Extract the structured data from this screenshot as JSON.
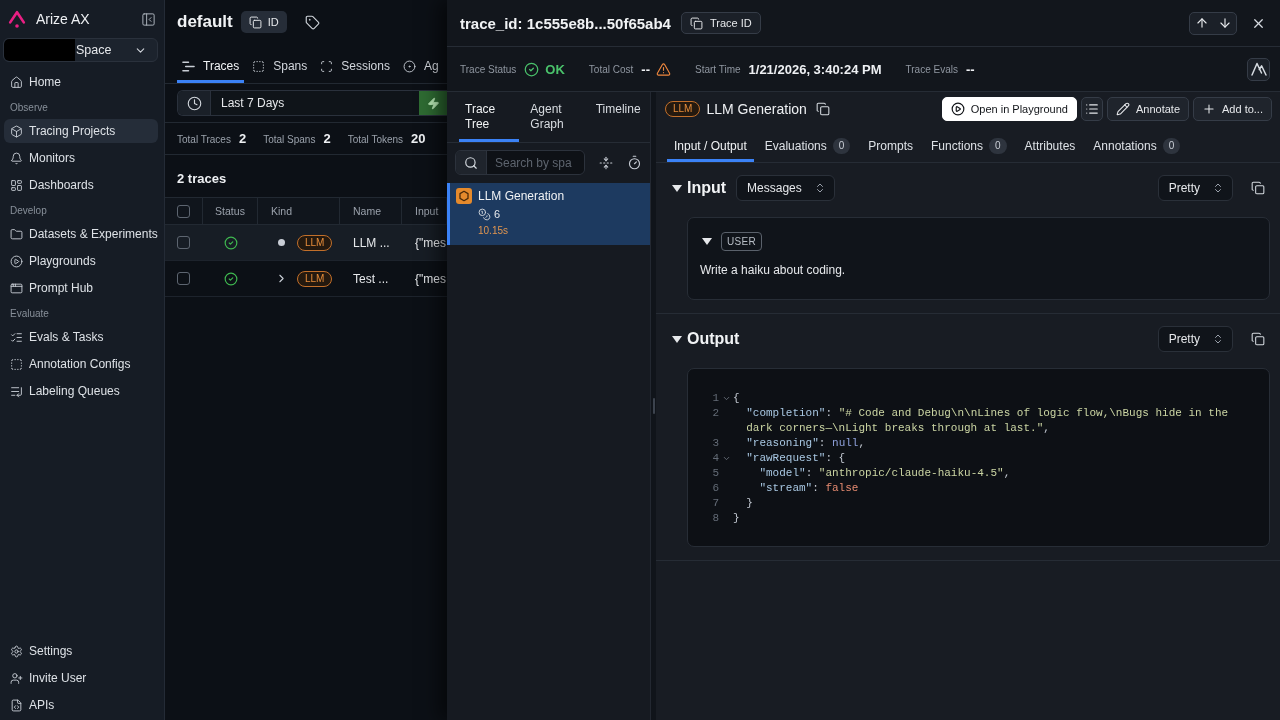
{
  "sidebar": {
    "brand": "Arize AX",
    "workspace": "Space",
    "groups": [
      {
        "items": [
          {
            "label": "Home",
            "selected": false
          }
        ]
      },
      {
        "heading": "Observe",
        "items": [
          {
            "label": "Tracing Projects",
            "selected": true
          },
          {
            "label": "Monitors",
            "selected": false
          },
          {
            "label": "Dashboards",
            "selected": false
          }
        ]
      },
      {
        "heading": "Develop",
        "items": [
          {
            "label": "Datasets & Experiments",
            "selected": false
          },
          {
            "label": "Playgrounds",
            "selected": false
          },
          {
            "label": "Prompt Hub",
            "selected": false
          }
        ]
      },
      {
        "heading": "Evaluate",
        "items": [
          {
            "label": "Evals & Tasks",
            "selected": false
          },
          {
            "label": "Annotation Configs",
            "selected": false
          },
          {
            "label": "Labeling Queues",
            "selected": false
          }
        ]
      }
    ],
    "footer_items": [
      {
        "label": "Settings",
        "selected": false
      },
      {
        "label": "Invite User",
        "selected": false
      },
      {
        "label": "APIs",
        "selected": false
      }
    ]
  },
  "project": {
    "title": "default",
    "id_button": "ID",
    "tabs": [
      {
        "label": "Traces",
        "selected": true
      },
      {
        "label": "Spans",
        "selected": false
      },
      {
        "label": "Sessions",
        "selected": false
      },
      {
        "label": "Ag",
        "selected": false
      }
    ],
    "time_range": "Last 7 Days",
    "stats": [
      {
        "label": "Total Traces",
        "value": "2"
      },
      {
        "label": "Total Spans",
        "value": "2"
      },
      {
        "label": "Total Tokens",
        "value": "20"
      }
    ],
    "result_count": "2 traces",
    "table": {
      "header_checked": false,
      "columns": [
        "Status",
        "Kind",
        "Name",
        "Input"
      ],
      "rows": [
        {
          "selected": true,
          "checked": false,
          "status_ok": true,
          "expandable": false,
          "span_kind": "LLM",
          "name": "LLM ...",
          "input": "{\"mes"
        },
        {
          "selected": false,
          "checked": false,
          "status_ok": true,
          "expandable": true,
          "span_kind": "LLM",
          "name": "Test ...",
          "input": "{\"mes"
        }
      ]
    }
  },
  "trace_panel": {
    "title": "trace_id: 1c555e8b...50f65ab4",
    "copy_button": "Trace ID",
    "meta": [
      {
        "kind": "status",
        "label": "Trace Status",
        "value": "OK"
      },
      {
        "kind": "warning",
        "label": "Total Cost",
        "value": "--"
      },
      {
        "kind": "plain",
        "label": "Start Time",
        "value": "1/21/2026, 3:40:24 PM"
      },
      {
        "kind": "plain",
        "label": "Trace Evals",
        "value": "--"
      }
    ],
    "tree": {
      "tabs": [
        {
          "label": "Trace Tree",
          "selected": true
        },
        {
          "label": "Agent Graph",
          "selected": false
        },
        {
          "label": "Timeline",
          "selected": false
        }
      ],
      "search": {
        "placeholder": "Search by spa"
      },
      "spans": [
        {
          "name": "LLM Generation",
          "tokens": "6",
          "duration": "10.15s",
          "selected": true
        }
      ]
    },
    "span": {
      "span_kind": "LLM",
      "title": "LLM Generation",
      "actions": [
        {
          "kind": "primary",
          "label": "Open in Playground"
        },
        {
          "kind": "icon"
        },
        {
          "kind": "secondary",
          "label": "Annotate"
        },
        {
          "kind": "secondary",
          "label": "Add to..."
        }
      ],
      "tabs": [
        {
          "label": "Input / Output",
          "selected": true
        },
        {
          "label": "Evaluations",
          "count": "0",
          "selected": false
        },
        {
          "label": "Prompts",
          "selected": false
        },
        {
          "label": "Functions",
          "count": "0",
          "selected": false
        },
        {
          "label": "Attributes",
          "selected": false
        },
        {
          "label": "Annotations",
          "count": "0",
          "selected": false
        }
      ],
      "input": {
        "title": "Input",
        "expanded": true,
        "format": "Messages",
        "view": "Pretty",
        "messages": [
          {
            "role": "USER",
            "expanded": true,
            "text": "Write a haiku about coding."
          }
        ]
      },
      "output": {
        "title": "Output",
        "expanded": true,
        "view": "Pretty",
        "code": [
          {
            "number": "1",
            "foldable": true,
            "tokens": [
              {
                "kind": "punct",
                "text": "{"
              }
            ]
          },
          {
            "number": "2",
            "foldable": false,
            "tokens": [
              {
                "kind": "key",
                "text": "  \"completion\""
              },
              {
                "kind": "punct",
                "text": ": "
              },
              {
                "kind": "string",
                "text": "\"# Code and Debug\\n\\nLines of logic flow,\\nBugs hide in the dark corners—\\nLight breaks through at last.\""
              },
              {
                "kind": "punct",
                "text": ","
              }
            ]
          },
          {
            "number": "3",
            "foldable": false,
            "tokens": [
              {
                "kind": "key",
                "text": "  \"reasoning\""
              },
              {
                "kind": "punct",
                "text": ": "
              },
              {
                "kind": "null",
                "text": "null"
              },
              {
                "kind": "punct",
                "text": ","
              }
            ]
          },
          {
            "number": "4",
            "foldable": true,
            "tokens": [
              {
                "kind": "key",
                "text": "  \"rawRequest\""
              },
              {
                "kind": "punct",
                "text": ": {"
              }
            ]
          },
          {
            "number": "5",
            "foldable": false,
            "tokens": [
              {
                "kind": "key",
                "text": "    \"model\""
              },
              {
                "kind": "punct",
                "text": ": "
              },
              {
                "kind": "string",
                "text": "\"anthropic/claude-haiku-4.5\""
              },
              {
                "kind": "punct",
                "text": ","
              }
            ]
          },
          {
            "number": "6",
            "foldable": false,
            "tokens": [
              {
                "kind": "key",
                "text": "    \"stream\""
              },
              {
                "kind": "punct",
                "text": ": "
              },
              {
                "kind": "boolean",
                "text": "false"
              }
            ]
          },
          {
            "number": "7",
            "foldable": false,
            "tokens": [
              {
                "kind": "punct",
                "text": "  }"
              }
            ]
          },
          {
            "number": "8",
            "foldable": false,
            "tokens": [
              {
                "kind": "punct",
                "text": "}"
              }
            ]
          }
        ]
      }
    }
  }
}
